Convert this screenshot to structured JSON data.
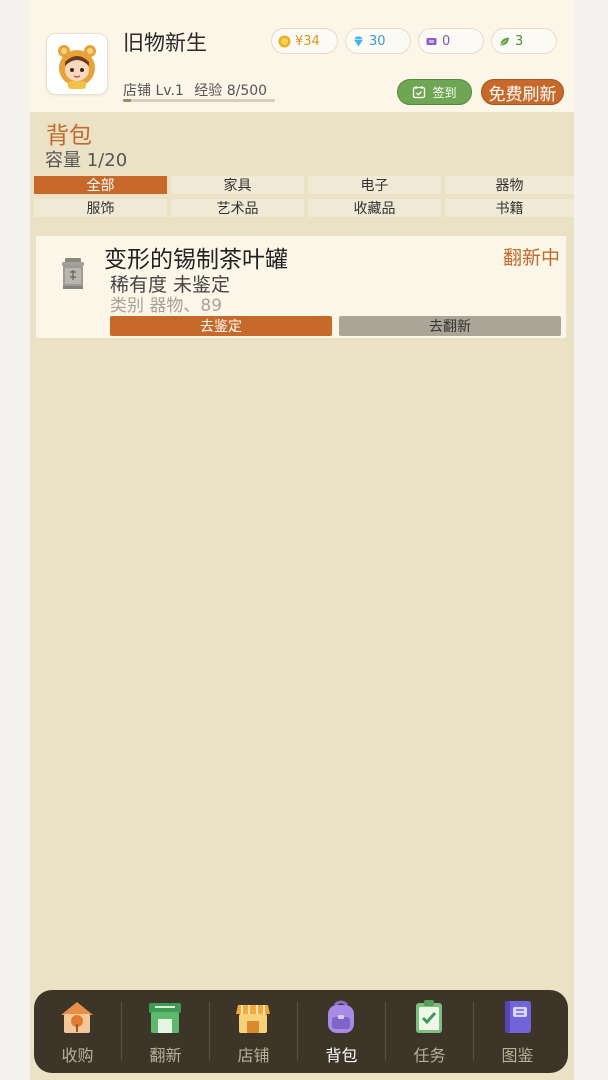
{
  "header": {
    "app_title": "旧物新生",
    "shop_level": "店铺 Lv.1",
    "experience": "经验 8/500",
    "experience_progress": 0.016,
    "currencies": [
      {
        "name": "coin",
        "icon": "coin-icon",
        "value": "¥34",
        "color": "#e0a31c"
      },
      {
        "name": "diamond",
        "icon": "diamond-icon",
        "value": "30",
        "color": "#3aa6e0"
      },
      {
        "name": "ticket",
        "icon": "ticket-icon",
        "value": "0",
        "color": "#8a5fc8"
      },
      {
        "name": "leaf",
        "icon": "leaf-icon",
        "value": "3",
        "color": "#5ea23e"
      }
    ],
    "signin_label": "签到",
    "free_refresh_label": "免费刷新"
  },
  "backpack": {
    "title": "背包",
    "capacity": "容量 1/20",
    "tabs": [
      "全部",
      "家具",
      "电子",
      "器物",
      "服饰",
      "艺术品",
      "收藏品",
      "书籍"
    ],
    "active_tab": "全部"
  },
  "items": [
    {
      "name": "变形的锡制茶叶罐",
      "status": "翻新中",
      "rarity": "稀有度 未鉴定",
      "category": "类别 器物、89",
      "icon": "tea-canister-icon",
      "appraise_label": "去鉴定",
      "renovate_label": "去翻新"
    }
  ],
  "nav": [
    {
      "label": "收购",
      "icon": "house-tree-icon",
      "active": false
    },
    {
      "label": "翻新",
      "icon": "workshop-icon",
      "active": false
    },
    {
      "label": "店铺",
      "icon": "shop-icon",
      "active": false
    },
    {
      "label": "背包",
      "icon": "backpack-icon",
      "active": true
    },
    {
      "label": "任务",
      "icon": "clipboard-check-icon",
      "active": false
    },
    {
      "label": "图鉴",
      "icon": "book-icon",
      "active": false
    }
  ],
  "colors": {
    "accent": "#c6692b",
    "success": "#6fa653",
    "background": "#ebe2c6",
    "header_bg": "#fbf6e8",
    "nav_bg": "#3d3528"
  }
}
